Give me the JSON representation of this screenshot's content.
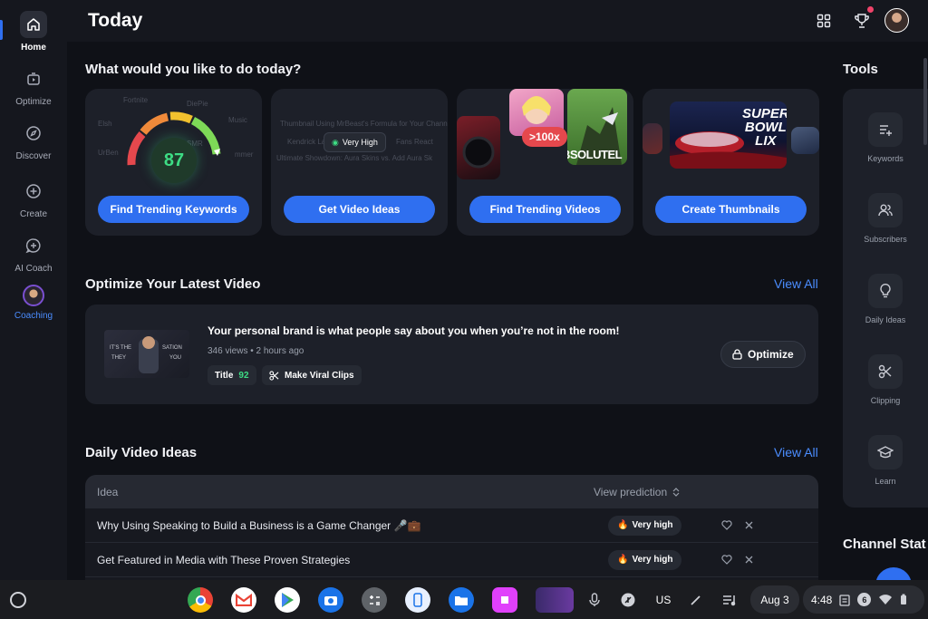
{
  "colors": {
    "accent": "#2f6ff0",
    "link": "#4b8dff",
    "score_green": "#3ddc84",
    "badge_red": "#e5484d"
  },
  "sidebar": {
    "items": [
      {
        "label": "Home",
        "icon": "home-icon",
        "active": true
      },
      {
        "label": "Optimize",
        "icon": "optimize-icon"
      },
      {
        "label": "Discover",
        "icon": "compass-icon"
      },
      {
        "label": "Create",
        "icon": "plus-circle-icon"
      },
      {
        "label": "AI Coach",
        "icon": "ai-chat-icon"
      },
      {
        "label": "Coaching",
        "icon": "coach-avatar"
      }
    ]
  },
  "header": {
    "title": "Today",
    "icons": [
      "apps-grid-icon",
      "trophy-icon",
      "user-avatar"
    ]
  },
  "actions": {
    "title": "What would you like to do today?",
    "cards": [
      {
        "button": "Find Trending Keywords",
        "score": "87",
        "faded_words": [
          "Fortnite",
          "DiePie",
          "Elsh",
          "Music",
          "SMR",
          "UrBen",
          "mmer"
        ]
      },
      {
        "button": "Get Video Ideas",
        "pill": "Very High",
        "faded_lines": [
          "Thumbnail Using MrBeast's Formula for Your Channel",
          "Kendrick La",
          "Fans React",
          "Ultimate Showdown: Aura Skins vs. Add Aura Sk"
        ]
      },
      {
        "button": "Find Trending Videos",
        "badge": ">100x",
        "thumb_text": "BSOLUTEL"
      },
      {
        "button": "Create Thumbnails",
        "thumb_text": [
          "SUPER",
          "BOWL",
          "LIX"
        ]
      }
    ]
  },
  "optimize": {
    "title": "Optimize Your Latest Video",
    "view_all": "View All",
    "video": {
      "title": "Your personal brand is what people say about you when you’re not in the room!",
      "meta": "346 views • 2 hours ago",
      "thumb_text": [
        "IT'S THE",
        "SATION",
        "THEY",
        "YOU"
      ],
      "chips": [
        {
          "label": "Title",
          "value": "92"
        },
        {
          "label": "Make Viral Clips",
          "icon": "scissors-icon"
        }
      ],
      "button": "Optimize"
    }
  },
  "daily": {
    "title": "Daily Video Ideas",
    "view_all": "View All",
    "columns": {
      "idea": "Idea",
      "prediction": "View prediction"
    },
    "rows": [
      {
        "idea": "Why Using Speaking to Build a Business is a Game Changer 🎤💼",
        "prediction": "Very high"
      },
      {
        "idea": "Get Featured in Media with These Proven Strategies",
        "prediction": "Very high"
      }
    ]
  },
  "tools": {
    "title": "Tools",
    "items": [
      {
        "label": "Keywords",
        "icon": "keywords-icon"
      },
      {
        "label": "Subscribers",
        "icon": "users-icon"
      },
      {
        "label": "Daily Ideas",
        "icon": "lightbulb-icon"
      },
      {
        "label": "Clipping",
        "icon": "scissors-icon"
      },
      {
        "label": "Learn",
        "icon": "graduation-cap-icon"
      }
    ],
    "next_section": "Channel Stat"
  },
  "taskbar": {
    "apps": [
      "chrome-icon",
      "gmail-icon",
      "play-store-icon",
      "camera-icon",
      "calculator-icon",
      "phone-hub-icon",
      "files-icon",
      "app-icon",
      "video-thumb-icon"
    ],
    "tray": {
      "lang": "US",
      "date": "Aug 3",
      "time": "4:48",
      "notifications": "6"
    }
  }
}
